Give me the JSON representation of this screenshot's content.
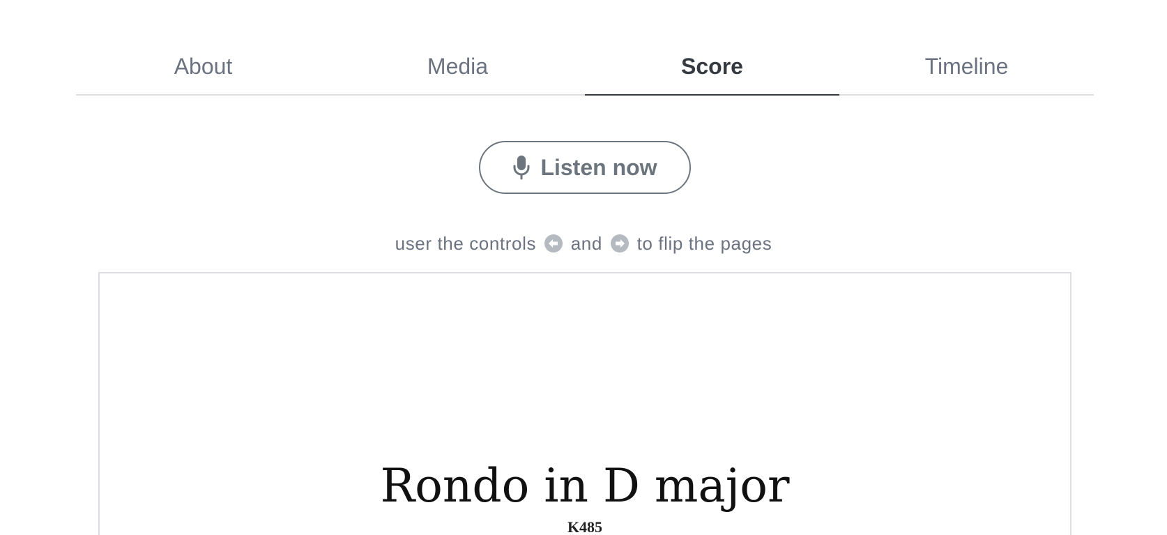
{
  "tabs": [
    {
      "label": "About",
      "active": false
    },
    {
      "label": "Media",
      "active": false
    },
    {
      "label": "Score",
      "active": true
    },
    {
      "label": "Timeline",
      "active": false
    }
  ],
  "listen_button": {
    "label": "Listen now",
    "icon": "microphone-icon"
  },
  "hint": {
    "prefix": "user the controls",
    "middle": "and",
    "suffix": "to flip the pages",
    "left_icon": "arrow-left-circle-icon",
    "right_icon": "arrow-right-circle-icon"
  },
  "score": {
    "title": "Rondo in D major",
    "subtitle": "K485"
  },
  "colors": {
    "tab_inactive": "#6b7280",
    "tab_active": "#343a40",
    "divider": "#dcdee1",
    "button": "#6c757d",
    "hint_icon": "#b5b9c0"
  }
}
